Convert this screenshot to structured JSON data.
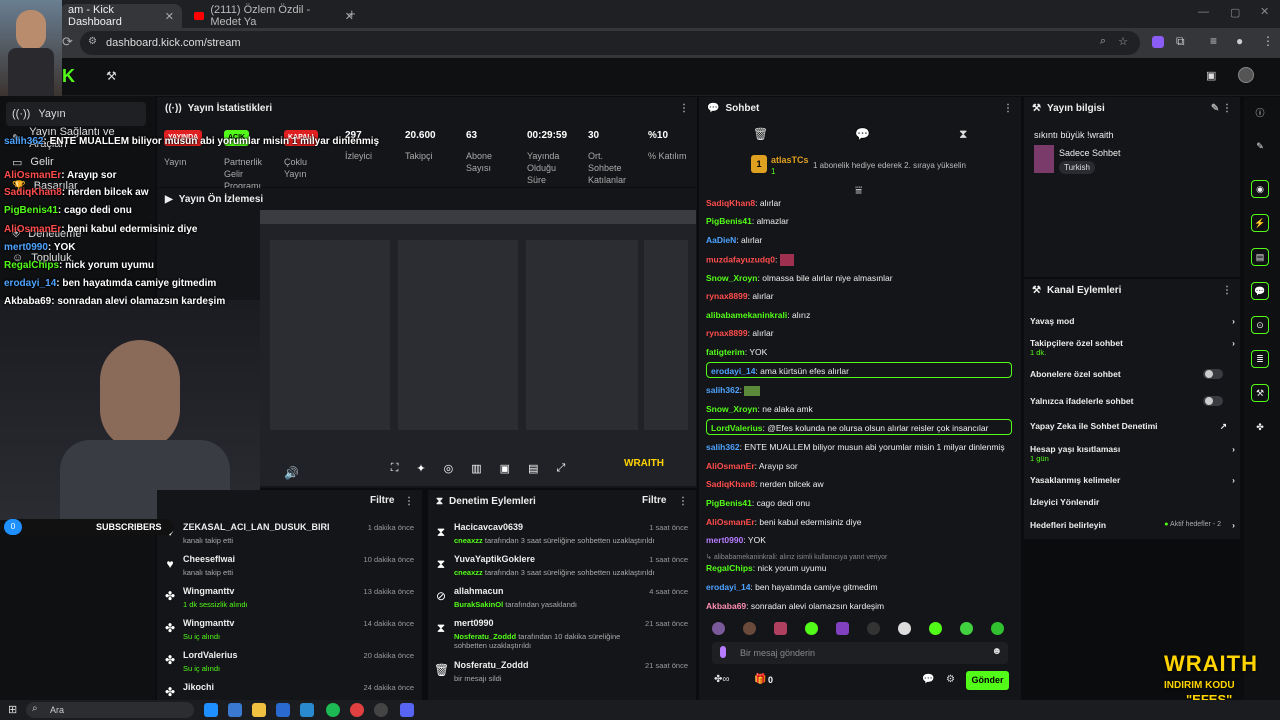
{
  "browser": {
    "tabs": [
      {
        "title": "am - Kick Dashboard",
        "active": true
      },
      {
        "title": "(2111) Özlem Özdil - Medet Ya",
        "active": false
      }
    ],
    "url": "dashboard.kick.com/stream"
  },
  "left_nav": {
    "items": [
      {
        "label": "Yayın",
        "icon": "broadcast-icon"
      },
      {
        "label": "Yayın Sağlantı ve Araçları",
        "icon": "tools-icon"
      },
      {
        "label": "Gelir",
        "icon": "wallet-icon"
      },
      {
        "label": "Başarılar",
        "icon": "trophy-icon"
      },
      {
        "label": "Denetleme",
        "icon": "shield-icon"
      },
      {
        "label": "Topluluk",
        "icon": "people-icon"
      }
    ]
  },
  "stats": {
    "title": "Yayın İstatistikleri",
    "badges": [
      "YAYINDA",
      "AÇIK",
      "KAPALI"
    ],
    "items": [
      {
        "value": "",
        "label": "Yayın"
      },
      {
        "value": "",
        "label": "Partnerlik Gelir Programı"
      },
      {
        "value": "",
        "label": "Çoklu Yayın"
      },
      {
        "value": "297",
        "label": "İzleyici"
      },
      {
        "value": "20.600",
        "label": "Takipçi"
      },
      {
        "value": "63",
        "label": "Abone Sayısı"
      },
      {
        "value": "00:29:59",
        "label": "Yayında Olduğu Süre"
      },
      {
        "value": "30",
        "label": "Ort. Sohbete Katılanlar"
      },
      {
        "value": "%10",
        "label": "% Katılım"
      }
    ]
  },
  "preview": {
    "title": "Yayın Ön İzlemesi",
    "overlay_brand": "WRAITH",
    "overlay_sub": "INDIRIM KODU"
  },
  "activity": {
    "filter_label": "Filtre",
    "subscribers_label": "SUBSCRIBERS",
    "subscribers_count": "0",
    "items": [
      {
        "name": "ZEKASAL_ACI_LAN_DUSUK_BIRI",
        "sub": "kanalı takip etti",
        "time": "1 dakika önce",
        "icon": "heart-icon"
      },
      {
        "name": "Cheeseflwai",
        "sub": "kanalı takip etti",
        "time": "10 dakika önce",
        "icon": "heart-icon"
      },
      {
        "name": "Wingmanttv",
        "sub": "1 dk sessizlik alındı",
        "time": "13 dakika önce",
        "icon": "emote-icon"
      },
      {
        "name": "Wingmanttv",
        "sub": "Su iç alındı",
        "time": "14 dakika önce",
        "icon": "emote-icon"
      },
      {
        "name": "LordValerius",
        "sub": "Su iç alındı",
        "time": "20 dakika önce",
        "icon": "emote-icon"
      },
      {
        "name": "Jikochi",
        "sub": "",
        "time": "24 dakika önce",
        "icon": "emote-icon"
      }
    ]
  },
  "moderation": {
    "title": "Denetim Eylemleri",
    "filter_label": "Filtre",
    "items": [
      {
        "name": "Hacicavcav0639",
        "by": "cneaxzz",
        "rest": "tarafından 3 saat süreliğine sohbetten uzaklaştırıldı",
        "time": "1 saat önce",
        "icon": "hourglass-icon"
      },
      {
        "name": "YuvaYaptikGoklere",
        "by": "cneaxzz",
        "rest": "tarafından 3 saat süreliğine sohbetten uzaklaştırıldı",
        "time": "1 saat önce",
        "icon": "hourglass-icon"
      },
      {
        "name": "allahmacun",
        "by": "BurakSakinOl",
        "rest": "tarafından yasaklandı",
        "time": "4 saat önce",
        "icon": "ban-icon"
      },
      {
        "name": "mert0990",
        "by": "Nosferatu_Zoddd",
        "rest": "tarafından 10 dakika süreliğine sohbetten uzaklaştırıldı",
        "time": "21 saat önce",
        "icon": "hourglass-icon"
      },
      {
        "name": "Nosferatu_Zoddd",
        "by": "",
        "rest": "bir mesajı sildi",
        "time": "21 saat önce",
        "icon": "trash-icon"
      }
    ]
  },
  "chat": {
    "title": "Sohbet",
    "gift_user": "atlasTCs",
    "gift_count": "1",
    "gift_text": "1 abonelik hediye ederek 2. sıraya yükselin",
    "messages": [
      {
        "user": "SadiqKhan8",
        "text": "alırlar",
        "color": "#ff4d4d"
      },
      {
        "user": "PigBenis41",
        "text": "almazlar",
        "color": "#53fc18"
      },
      {
        "user": "AaDieN",
        "text": "alırlar",
        "color": "#4da3ff"
      },
      {
        "user": "muzdafayuzudq0",
        "text": "",
        "color": "#ff4d4d"
      },
      {
        "user": "Snow_Xroyn",
        "text": "olmassa bile alırlar niye almasınlar",
        "color": "#53fc18"
      },
      {
        "user": "rynax8899",
        "text": "alırlar",
        "color": "#ff4d4d"
      },
      {
        "user": "alibabamekaninkrali",
        "text": "alırız",
        "color": "#53fc18"
      },
      {
        "user": "rynax8899",
        "text": "alırlar",
        "color": "#ff4d4d"
      },
      {
        "user": "fatigterim",
        "text": "YOK",
        "color": "#53fc18"
      },
      {
        "user": "erodayi_14",
        "text": "ama kürtsün efes alırlar",
        "color": "#4da3ff"
      },
      {
        "user": "salih362",
        "text": "",
        "color": "#4da3ff"
      },
      {
        "user": "Snow_Xroyn",
        "text": "ne alaka amk",
        "color": "#53fc18"
      },
      {
        "user": "LordValerius",
        "text": "@Efes kolunda ne olursa olsun alırlar reisler çok insancılar",
        "color": "#53fc18"
      },
      {
        "user": "salih362",
        "text": "ENTE MUALLEM biliyor musun abi yorumlar misin 1 milyar dinlenmiş",
        "color": "#4da3ff"
      },
      {
        "user": "AliOsmanEr",
        "text": "Arayıp sor",
        "color": "#ff4d4d"
      },
      {
        "user": "SadiqKhan8",
        "text": "nerden bilcek aw",
        "color": "#ff4d4d"
      },
      {
        "user": "PigBenis41",
        "text": "cago dedi onu",
        "color": "#53fc18"
      },
      {
        "user": "AliOsmanEr",
        "text": "beni kabul edermisiniz diye",
        "color": "#ff4d4d"
      },
      {
        "user": "mert0990",
        "text": "YOK",
        "color": "#b77cff"
      },
      {
        "user": "RegalChips",
        "text": "nick yorum uyumu",
        "color": "#53fc18"
      },
      {
        "user": "erodayi_14",
        "text": "ben hayatımda camiye gitmedim",
        "color": "#4da3ff"
      },
      {
        "user": "Akbaba69",
        "text": "sonradan alevi olamazsın kardeşim",
        "color": "#ff8fb1"
      }
    ],
    "reply_hint": "alibabamekaninkrali: alırız isimli kullanıcıya yanıt veriyor",
    "input_placeholder": "Bir mesaj gönderin",
    "send_label": "Gönder",
    "footer_count": "0"
  },
  "stream_info": {
    "title": "Yayın bilgisi",
    "stream_title": "sıkıntı büyük !wraith",
    "category": "Sadece Sohbet",
    "tag": "Turkish"
  },
  "channel_actions": {
    "title": "Kanal Eylemleri",
    "items": [
      {
        "label": "Yavaş mod",
        "sub": "",
        "control": "chevron"
      },
      {
        "label": "Takipçilere özel sohbet",
        "sub": "1 dk.",
        "control": "chevron"
      },
      {
        "label": "Abonelere özel sohbet",
        "sub": "",
        "control": "toggle"
      },
      {
        "label": "Yalnızca ifadelerle sohbet",
        "sub": "",
        "control": "toggle"
      },
      {
        "label": "Yapay Zeka ile Sohbet Denetimi",
        "sub": "",
        "control": "external"
      },
      {
        "label": "Hesap yaşı kısıtlaması",
        "sub": "1 gün",
        "control": "chevron"
      },
      {
        "label": "Yasaklanmış kelimeler",
        "sub": "",
        "control": "chevron"
      },
      {
        "label": "İzleyici Yönlendir",
        "sub": "",
        "control": "none"
      },
      {
        "label": "Hedefleri belirleyin",
        "sub": "",
        "control": "chevron",
        "status": "Aktif hedefler - 2"
      }
    ]
  },
  "overlay_chat": [
    {
      "user": "salih362",
      "text": "ENTE MUALLEM biliyor musun abi yorumlar misin 1 milyar dinlenmiş",
      "color": "#4da3ff"
    },
    {
      "user": "AliOsmanEr",
      "text": "Arayıp sor",
      "color": "#ff4d4d"
    },
    {
      "user": "SadiqKhan8",
      "text": "nerden bilcek aw",
      "color": "#ff4d4d"
    },
    {
      "user": "PigBenis41",
      "text": "cago dedi onu",
      "color": "#53fc18"
    },
    {
      "user": "AliOsmanEr",
      "text": "beni kabul edermisiniz diye",
      "color": "#ff4d4d"
    },
    {
      "user": "mert0990",
      "text": "YOK",
      "color": "#4da3ff"
    },
    {
      "user": "RegalChips",
      "text": "nick yorum uyumu",
      "color": "#53fc18"
    },
    {
      "user": "erodayi_14",
      "text": "ben hayatımda camiye gitmedim",
      "color": "#4da3ff"
    },
    {
      "user": "Akbaba69",
      "text": "sonradan alevi olamazsın kardeşim",
      "color": "#ffffff"
    }
  ],
  "watermark": {
    "brand": "WRAITH",
    "line1": "INDIRIM KODU",
    "line2": "\"EFES\""
  },
  "taskbar": {
    "search_label": "Ara"
  },
  "colors": {
    "accent": "#53fc18",
    "live": "#e02020",
    "bg": "#0b0c0e",
    "panel": "#141518"
  }
}
